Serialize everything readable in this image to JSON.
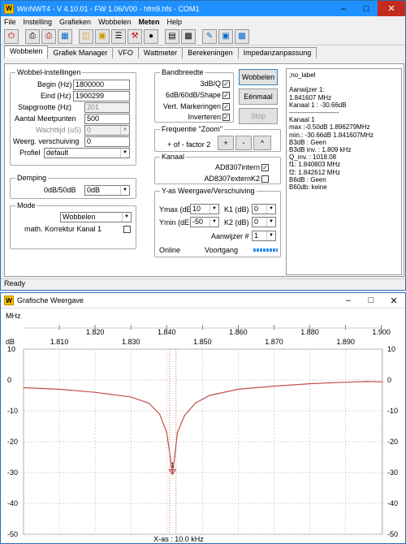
{
  "main_window": {
    "title": "WinNWT4 - V 4.10.01 - FW 1.06/V00 - hfm9.hfs - COM1",
    "menu": [
      "File",
      "Instelling",
      "Grafieken",
      "Wobbelen",
      "Meten",
      "Help"
    ],
    "toolbar_icons": [
      "power-icon",
      "printer-icon",
      "printer-color-icon",
      "save-image-icon",
      "folder-open-icon",
      "folder-icon",
      "notes-icon",
      "tool-icon",
      "penguin-icon",
      "chart-icon",
      "chart-settings-icon",
      "probe-icon",
      "disk-icon",
      "save-icon"
    ],
    "tabs": [
      "Wobbelen",
      "Grafiek Manager",
      "VFO",
      "Wattmeter",
      "Berekeningen",
      "Impedanzanpassung"
    ],
    "active_tab": "Wobbelen",
    "status": "Ready"
  },
  "wobbel": {
    "title": "Wobbel-instellingen",
    "begin_label": "Begin (Hz)",
    "begin_value": "1800000",
    "end_label": "Eind (Hz)",
    "end_value": "1900299",
    "step_label": "Stapgrootte (Hz)",
    "step_value": "201",
    "points_label": "Aantal Meetpunten",
    "points_value": "500",
    "wait_label": "Wachttijd (uS)",
    "wait_value": "0",
    "shift_label": "Weerg. verschuiving",
    "shift_value": "0",
    "profile_label": "Profiel",
    "profile_value": "default"
  },
  "demping": {
    "title": "Demping",
    "label": "0dB/50dB",
    "value": "0dB"
  },
  "mode": {
    "title": "Mode",
    "value": "Wobbelen",
    "korrektur_label": "math. Korrektur Kanal 1"
  },
  "bandbreedte": {
    "title": "Bandbreedte",
    "items": [
      {
        "label": "3dB/Q",
        "checked": "✓"
      },
      {
        "label": "6dB/60dB/Shape",
        "checked": "✓"
      },
      {
        "label": "Vert. Markeringen",
        "checked": "✓"
      },
      {
        "label": "Inverteren",
        "checked": "✓"
      }
    ]
  },
  "buttons": {
    "wobbelen": "Wobbelen",
    "eenmaal": "Eénmaal",
    "stop": "Stop"
  },
  "zoom": {
    "title": "Frequentie \"Zoom\"",
    "label": "+ of - factor 2",
    "plus": "+",
    "minus": "-",
    "caret": "^"
  },
  "kanaal": {
    "title": "Kanaal",
    "intern_label": "AD8307intern",
    "intern_checked": "✓",
    "extern_label": "AD8307externK2",
    "extern_checked": ""
  },
  "yas": {
    "title": "Y-as  Weergave/Verschuiving",
    "ymax_label": "Ymax (dE",
    "ymax_value": "10",
    "ymin_label": "Ymin  (dE",
    "ymin_value": "-50",
    "k1_label": "K1 (dB)",
    "k1_value": "0",
    "k2_label": "K2 (dB)",
    "k2_value": "0",
    "marker_label": "Aanwijzer #",
    "marker_value": "1",
    "online": "Online",
    "progress_label": "Voortgang",
    "progress_value": 1.0
  },
  "results": {
    "lines": [
      ";no_label",
      "",
      "Aanwijzer 1:",
      "1.841607 MHz",
      "Kanaal 1 : -30.66dB",
      "-----------------------",
      "Kanaal 1",
      "max :-0.50dB 1.896279MHz",
      "min.: -30.66dB 1.841607MHz",
      "B3dB : Geen",
      "B3dB inv. : 1.809 kHz",
      "Q_inv. : 1018.08",
      "f1: 1.840803 MHz",
      "f2: 1.842612 MHz",
      "B6dB : Geen",
      "B60db: keine"
    ]
  },
  "graph_window": {
    "title": "Grafische Weergave",
    "xspan_label": "X-as : 10.0 kHz"
  },
  "chart_data": {
    "type": "line",
    "title": "",
    "xlabel": "X-as : 10.0 kHz",
    "ylabel": "dB",
    "xlabel_top_unit": "MHz",
    "xlim": [
      1.8,
      1.9003
    ],
    "ylim": [
      -50,
      10
    ],
    "x_ticks_top": [
      "1.810",
      "1.820",
      "1.830",
      "1.840",
      "1.850",
      "1.860",
      "1.870",
      "1.880",
      "1.890",
      "1.900"
    ],
    "x_tick_values": [
      1.81,
      1.82,
      1.83,
      1.84,
      1.85,
      1.86,
      1.87,
      1.88,
      1.89,
      1.9
    ],
    "y_ticks": [
      10,
      0,
      -10,
      -20,
      -30,
      -40,
      -50
    ],
    "grid": true,
    "marker": {
      "x": 1.841607,
      "y": -30.66,
      "label": "1"
    },
    "vertical_markers": [
      1.840803,
      1.842612
    ],
    "series": [
      {
        "color": "#c0504d",
        "x": [
          1.8,
          1.81,
          1.82,
          1.83,
          1.835,
          1.838,
          1.84,
          1.841,
          1.8416,
          1.8422,
          1.843,
          1.845,
          1.848,
          1.852,
          1.86,
          1.87,
          1.88,
          1.89,
          1.896,
          1.9003
        ],
        "y": [
          -2.5,
          -3.0,
          -4.0,
          -5.5,
          -7.5,
          -11.0,
          -17.0,
          -25.0,
          -30.66,
          -25.0,
          -17.0,
          -11.5,
          -7.5,
          -5.0,
          -3.0,
          -2.0,
          -1.2,
          -0.7,
          -0.5,
          -0.6
        ]
      }
    ]
  }
}
